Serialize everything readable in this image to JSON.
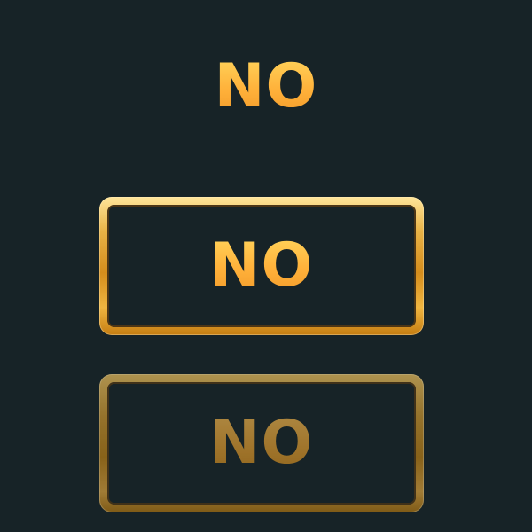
{
  "title_label": "NO",
  "buttons": [
    {
      "label": "NO",
      "state": "normal"
    },
    {
      "label": "NO",
      "state": "disabled"
    }
  ],
  "colors": {
    "background": "#172327",
    "gold_text": "#ffb13a",
    "gold_frame": "#e8b246"
  }
}
